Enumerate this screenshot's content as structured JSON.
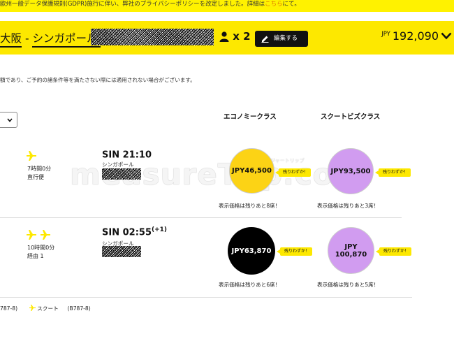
{
  "banner": {
    "text": "欧州一般データ保護規則(GDPR)施行に伴い、弊社のプライバシーポリシーを改定しました。詳細は",
    "link": "こちら",
    "suffix": "にて。"
  },
  "header": {
    "route_from": "大阪",
    "route_sep": " - ",
    "route_to": "シンガポール,",
    "pax_count": "x 2",
    "edit_label": "編集する",
    "currency": "JPY",
    "total": "192,090"
  },
  "notice": "額であり、ご予約の諸条件等を満たさない際には適用されない場合がございます。",
  "columns": {
    "economy": "エコノミークラス",
    "biz": "スクートビズクラス"
  },
  "flights": [
    {
      "duration": "7時間0分",
      "stops": "直行便",
      "arrival": "SIN 21:10",
      "arrival_plus": "",
      "city": "シンガポール",
      "economy_price": "JPY46,500",
      "economy_tag": "残りわずか！",
      "economy_seats": "表示価格は残りあと8席！",
      "biz_price": "JPY93,500",
      "biz_tag": "残りわずか！",
      "biz_seats": "表示価格は残りあと3席！"
    },
    {
      "duration": "10時間0分",
      "stops": "経由 1",
      "arrival": "SIN 02:55",
      "arrival_plus": "(+1)",
      "city": "シンガポール",
      "economy_price": "JPY63,870",
      "economy_tag": "残りわずか！",
      "economy_seats": "表示価格は残りあと6席！",
      "biz_price_line1": "JPY",
      "biz_price_line2": "100,870",
      "biz_tag": "残りわずか！",
      "biz_seats": "表示価格は残りあと5席！"
    }
  ],
  "footer": {
    "aircraft1": "787-8)",
    "airline": "スクート",
    "aircraft2": "(B787-8)"
  },
  "watermark": {
    "text": "measureTrip.com",
    "sub": "メジャートリップ"
  },
  "colors": {
    "brand_yellow": "#fde800",
    "economy": "#fcd315",
    "biz": "#d19cf0"
  },
  "icons": [
    "person-icon",
    "pencil-icon",
    "chevron-down-icon",
    "plane-icon"
  ]
}
